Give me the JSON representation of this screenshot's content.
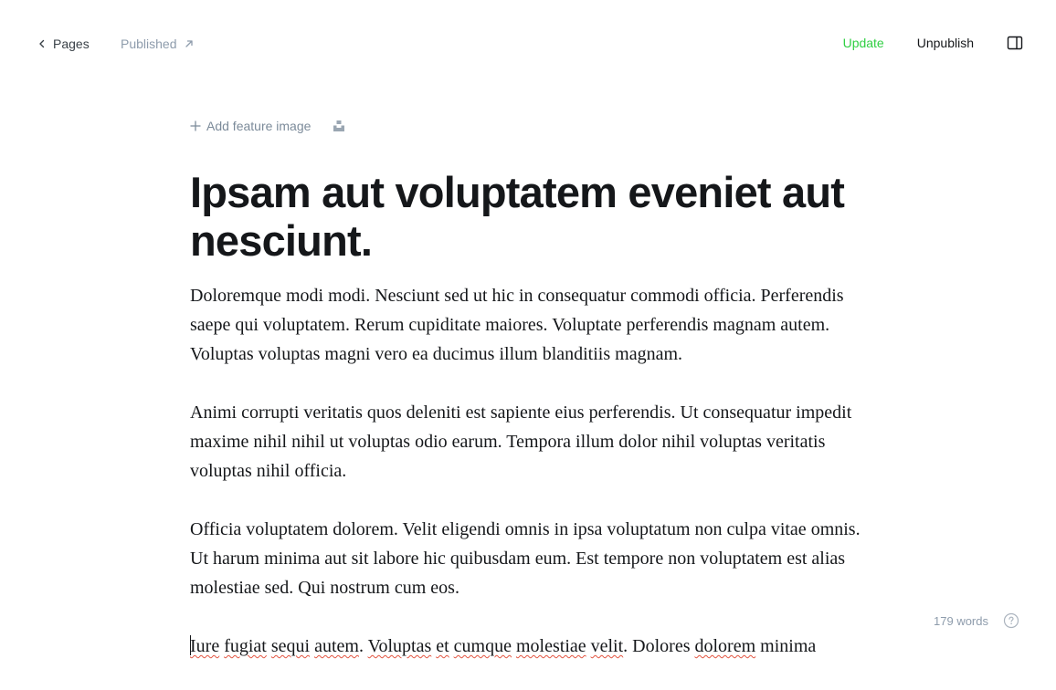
{
  "topbar": {
    "back_label": "Pages",
    "status_label": "Published",
    "update_label": "Update",
    "unpublish_label": "Unpublish",
    "icons": {
      "back": "chevron-left-icon",
      "status": "arrow-up-right-icon",
      "sidebar": "sidebar-toggle-icon"
    },
    "colors": {
      "update": "#30cf43",
      "status": "#8e9cac"
    }
  },
  "editor": {
    "add_feature_image_label": "Add feature image",
    "title": "Ipsam aut voluptatem eveniet aut nesciunt.",
    "paragraphs": [
      "Doloremque modi modi. Nesciunt sed ut hic in consequatur commodi officia. Perferendis saepe qui voluptatem. Rerum cupiditate maiores. Voluptate perferendis magnam autem. Voluptas voluptas magni vero ea ducimus illum blanditiis magnam.",
      "Animi corrupti veritatis quos deleniti est sapiente eius perferendis. Ut consequatur impedit maxime nihil nihil ut voluptas odio earum. Tempora illum dolor nihil voluptas veritatis voluptas nihil officia.",
      "Officia voluptatem dolorem. Velit eligendi omnis in ipsa voluptatum non culpa vitae omnis. Ut harum minima aut sit labore hic quibusdam eum. Est tempore non voluptatem est alias molestiae sed. Qui nostrum cum eos."
    ],
    "last_paragraph_words": [
      {
        "text": "Iure",
        "misspelled": true
      },
      {
        "text": " ",
        "misspelled": false
      },
      {
        "text": "fugiat",
        "misspelled": true
      },
      {
        "text": " ",
        "misspelled": false
      },
      {
        "text": "sequi",
        "misspelled": true
      },
      {
        "text": " ",
        "misspelled": false
      },
      {
        "text": "autem",
        "misspelled": true
      },
      {
        "text": ". ",
        "misspelled": false
      },
      {
        "text": "Voluptas",
        "misspelled": true
      },
      {
        "text": " ",
        "misspelled": false
      },
      {
        "text": "et",
        "misspelled": true
      },
      {
        "text": " ",
        "misspelled": false
      },
      {
        "text": "cumque",
        "misspelled": true
      },
      {
        "text": " ",
        "misspelled": false
      },
      {
        "text": "molestiae",
        "misspelled": true
      },
      {
        "text": " ",
        "misspelled": false
      },
      {
        "text": "velit",
        "misspelled": true
      },
      {
        "text": ". Dolores ",
        "misspelled": false
      },
      {
        "text": "dolorem",
        "misspelled": true
      },
      {
        "text": " minima",
        "misspelled": false
      }
    ],
    "icons": {
      "add": "plus-icon",
      "unsplash": "unsplash-icon"
    }
  },
  "footer": {
    "word_count": "179 words",
    "help_icon": "help-circle-icon"
  }
}
